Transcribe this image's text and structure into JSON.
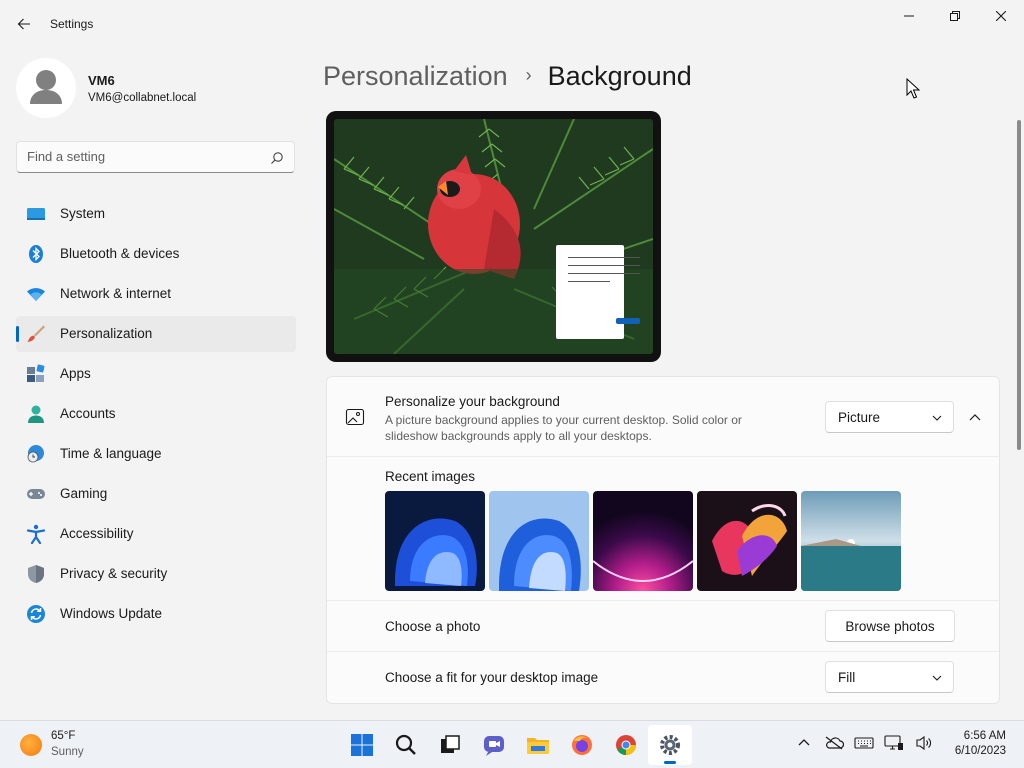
{
  "window": {
    "title": "Settings",
    "back_icon": "back-arrow-icon",
    "controls": [
      "minimize-icon",
      "restore-icon",
      "close-icon"
    ]
  },
  "user": {
    "name": "VM6",
    "email": "VM6@collabnet.local"
  },
  "search": {
    "placeholder": "Find a setting",
    "icon": "search-icon"
  },
  "sidebar": {
    "items": [
      {
        "label": "System",
        "icon": "system-icon"
      },
      {
        "label": "Bluetooth & devices",
        "icon": "bluetooth-icon"
      },
      {
        "label": "Network & internet",
        "icon": "wifi-icon"
      },
      {
        "label": "Personalization",
        "icon": "brush-icon",
        "active": true
      },
      {
        "label": "Apps",
        "icon": "apps-icon"
      },
      {
        "label": "Accounts",
        "icon": "accounts-icon"
      },
      {
        "label": "Time & language",
        "icon": "globe-clock-icon"
      },
      {
        "label": "Gaming",
        "icon": "gamepad-icon"
      },
      {
        "label": "Accessibility",
        "icon": "accessibility-icon"
      },
      {
        "label": "Privacy & security",
        "icon": "shield-icon"
      },
      {
        "label": "Windows Update",
        "icon": "update-icon"
      }
    ]
  },
  "breadcrumb": {
    "parent": "Personalization",
    "separator": "›",
    "current": "Background"
  },
  "background_card": {
    "title": "Personalize your background",
    "description": "A picture background applies to your current desktop. Solid color or slideshow backgrounds apply to all your desktops.",
    "type_value": "Picture",
    "recent_label": "Recent images",
    "recent_images": [
      "bloom-dark-icon",
      "bloom-light-icon",
      "glow-arc-icon",
      "flow-ribbon-icon",
      "lake-sunrise-icon"
    ],
    "choose_photo_label": "Choose a photo",
    "browse_label": "Browse photos",
    "fit_label": "Choose a fit for your desktop image",
    "fit_value": "Fill"
  },
  "taskbar": {
    "weather_temp": "65°F",
    "weather_cond": "Sunny",
    "apps": [
      "start-icon",
      "search-icon",
      "task-view-icon",
      "chat-icon",
      "file-explorer-icon",
      "firefox-icon",
      "chrome-icon",
      "settings-icon"
    ],
    "tray": [
      "chevron-up-icon",
      "onedrive-icon",
      "keyboard-icon",
      "network-icon",
      "volume-icon"
    ],
    "time": "6:56 AM",
    "date": "6/10/2023"
  },
  "colors": {
    "accent": "#0067c0",
    "window_bg": "#f3f3f3",
    "card_bg": "#fbfbfb"
  }
}
